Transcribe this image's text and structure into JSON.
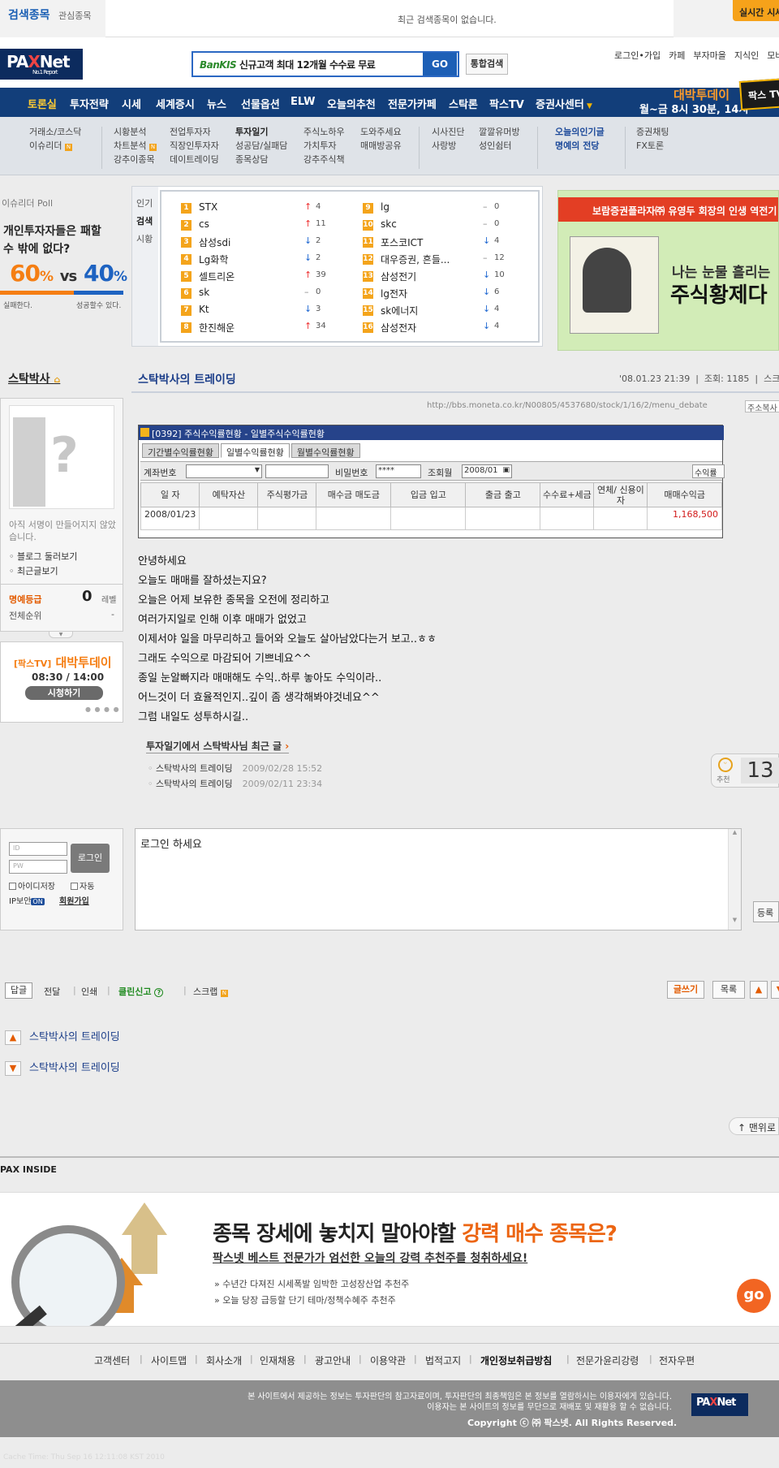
{
  "top_strip": {
    "tab_search": "검색종목",
    "tab_interest": "관심종목",
    "message": "최근 검색종목이 없습니다.",
    "realtime": "실시간 시세"
  },
  "header": {
    "logo_text": "PAXNet",
    "logo_sub": "No.1 Report",
    "search_brand": "BanKIS",
    "search_text": "신규고객 최대 12개월 수수료 무료",
    "go_label": "GO",
    "integrated_search": "통합검색",
    "links": [
      "로그인",
      "•가입",
      "카페",
      "부자마을",
      "지식인",
      "모바일"
    ]
  },
  "nav": {
    "items": [
      "토론실",
      "투자전략",
      "시세",
      "세계증시",
      "뉴스",
      "선물옵션",
      "ELW",
      "오늘의추천",
      "전문가카페",
      "스탁론",
      "팍스TV",
      "증권사센터"
    ],
    "active_index": 0,
    "promo_title": "대박투데이",
    "promo_time": "월~금 8시 30분, 14시",
    "tv_label": "팍스 TV"
  },
  "subnav": {
    "col1": [
      "거래소/코스닥",
      "이슈리더"
    ],
    "col2": [
      "시황분석",
      "차트분석",
      "강추이종목"
    ],
    "col3": [
      "전업투자자",
      "직장인투자자",
      "데이트레이딩"
    ],
    "col4": [
      "투자일기",
      "성공담/실패담",
      "종목상담"
    ],
    "col5": [
      "주식노하우",
      "가치투자",
      "강추주식책"
    ],
    "col6": [
      "도와주세요",
      "매매방공유"
    ],
    "col7": [
      "시사진단",
      "사랑방"
    ],
    "col8": [
      "깔깔유머방",
      "성인쉼터"
    ],
    "col9": [
      "오늘의인기글",
      "명예의 전당"
    ],
    "col10": [
      "증권채팅",
      "FX토론"
    ]
  },
  "poll": {
    "title": "이슈리더 Poll",
    "question_line1": "개인투자자들은 패할",
    "question_line2": "수 밖에 없다?",
    "left_pct": "60",
    "right_pct": "40",
    "pct_sign": "%",
    "vs": "vs",
    "left_fraction": 0.6,
    "left_label": "실패한다.",
    "right_label": "성공할수 있다."
  },
  "ranking": {
    "tabs": [
      "인기",
      "검색",
      "시황"
    ],
    "active_tab": 1,
    "left": [
      {
        "rank": "1",
        "name": "STX",
        "dir": "up",
        "change": "4"
      },
      {
        "rank": "2",
        "name": "cs",
        "dir": "up",
        "change": "11"
      },
      {
        "rank": "3",
        "name": "삼성sdi",
        "dir": "down",
        "change": "2"
      },
      {
        "rank": "4",
        "name": "Lg화학",
        "dir": "down",
        "change": "2"
      },
      {
        "rank": "5",
        "name": "셀트리온",
        "dir": "up",
        "change": "39"
      },
      {
        "rank": "6",
        "name": "sk",
        "dir": "same",
        "change": "0"
      },
      {
        "rank": "7",
        "name": "Kt",
        "dir": "down",
        "change": "3"
      },
      {
        "rank": "8",
        "name": "한진해운",
        "dir": "up",
        "change": "34"
      }
    ],
    "right": [
      {
        "rank": "9",
        "name": "lg",
        "dir": "same",
        "change": "0"
      },
      {
        "rank": "10",
        "name": "skc",
        "dir": "same",
        "change": "0"
      },
      {
        "rank": "11",
        "name": "포스코ICT",
        "dir": "down",
        "change": "4"
      },
      {
        "rank": "12",
        "name": "대우증권, 흔들...",
        "dir": "same",
        "change": "12"
      },
      {
        "rank": "13",
        "name": "삼성전기",
        "dir": "down",
        "change": "10"
      },
      {
        "rank": "14",
        "name": "lg전자",
        "dir": "down",
        "change": "6"
      },
      {
        "rank": "15",
        "name": "sk에너지",
        "dir": "down",
        "change": "4"
      },
      {
        "rank": "16",
        "name": "삼성전자",
        "dir": "down",
        "change": "4"
      }
    ]
  },
  "banner": {
    "top": "보람증권플라자㈜ 유영두 회장의 인생 역전기",
    "line1": "나는 눈물 흘리는",
    "line2": "주식황제다"
  },
  "profile": {
    "name": "스탁박사",
    "signature": "아직 서명이 만들어지지 않았습니다.",
    "blog_link": "블로그 둘러보기",
    "recent_link": "최근글보기",
    "honor_label": "명예등급",
    "honor_value": "0",
    "level_label": "레벨",
    "overall_label": "전체순위",
    "overall_value": "-"
  },
  "tv": {
    "tag": "[팍스TV]",
    "title": "대박투데이",
    "time": "08:30 / 14:00",
    "button": "시청하기"
  },
  "post": {
    "title": "스탁박사의 트레이딩",
    "date": "'08.01.23 21:39",
    "views_label": "조회:",
    "views": "1185",
    "scrap_label": "스크랩",
    "url": "http://bbs.moneta.co.kr/N00805/4537680/stock/1/16/2/menu_debate",
    "copy_label": "주소복사",
    "body": [
      "안녕하세요",
      "오늘도 매매를 잘하셨는지요?",
      "오늘은 어제 보유한 종목을 오전에 정리하고",
      "여러가지일로 인해 이후 매매가 없었고",
      "이제서야 일을 마무리하고 들어와 오늘도 살아남았다는거 보고..ㅎㅎ",
      "그래도 수익으로 마감되어 기쁘네요^^",
      "종일 눈알빠지라 매매해도 수익..하루 놓아도 수익이라..",
      "어느것이 더 효율적인지..깊이 좀 생각해봐야것네요^^",
      "그럼 내일도 성투하시길.."
    ],
    "recent_header": "투자일기에서 스탁박사님 최근 글",
    "recent": [
      {
        "title": "스탁박사의 트레이딩",
        "date": "2009/02/28 15:52"
      },
      {
        "title": "스탁박사의 트레이딩",
        "date": "2009/02/11 23:34"
      }
    ],
    "recommend_label": "추천",
    "recommend_count": "13"
  },
  "embedded": {
    "header": "[0392] 주식수익률현황 - 일별주식수익률현황",
    "tabs": [
      "기간별수익률현황",
      "일별수익률현황",
      "월별수익률현황"
    ],
    "active_tab": 1,
    "account_label": "계좌번호",
    "password_label": "비밀번호",
    "password_value": "****",
    "date_label": "조회월",
    "date_value": "2008/01",
    "profit_button": "수익률",
    "columns": [
      "일 자",
      "예탁자산",
      "주식평가금",
      "매수금 매도금",
      "입금 입고",
      "출금 출고",
      "수수료+세금",
      "연체/ 신용이자",
      "매매수익금"
    ],
    "row": {
      "date": "2008/01/23",
      "profit": "1,168,500"
    }
  },
  "login": {
    "id_placeholder": "ID",
    "pw_placeholder": "PW",
    "button": "로그인",
    "save_id": "아이디저장",
    "auto": "자동",
    "ip_label": "IP보안",
    "ip_state": "ON",
    "join": "회원가입"
  },
  "comment": {
    "placeholder": "로그인 하세요",
    "register": "등록"
  },
  "actions": {
    "reply": "답글",
    "forward": "전달",
    "print": "인쇄",
    "clean": "클린신고",
    "scrap": "스크랩",
    "write": "글쓰기",
    "list": "목록"
  },
  "prev_next": [
    "스탁박사의 트레이딩",
    "스탁박사의 트레이딩"
  ],
  "to_top": "맨위로",
  "pax_inside": {
    "title": "PAX INSIDE",
    "headline_a": "종목 장세에 놓치지 말아야할 ",
    "headline_b": "강력 매수 종목은?",
    "sub": "팍스넷 베스트 전문가가 엄선한 오늘의 강력 추천주를 청취하세요!",
    "items": [
      "» 수년간 다져진 시세폭발 임박한 고성장산업 추천주",
      "» 오늘 당장 급등할 단기 테마/정책수혜주 추천주"
    ],
    "go": "go"
  },
  "footer_links": [
    "고객센터",
    "사이트맵",
    "회사소개",
    "인재채용",
    "광고안내",
    "이용약관",
    "법적고지",
    "개인정보취급방침",
    "전문가윤리강령",
    "전자우편"
  ],
  "footer": {
    "disclaimer1": "본 사이트에서 제공하는 정보는 투자판단의 참고자료이며, 투자판단의 최종책임은 본 정보를 열람하시는 이용자에게 있습니다.",
    "disclaimer2": "이용자는 본 사이트의 정보를 무단으로 재배포 및 재활용 할 수 없습니다.",
    "copyright": "Copyright ⓒ ㈜ 팍스넷. All Rights Reserved.",
    "cache": "Cache Time: Thu Sep 16 12:11:08 KST 2010"
  },
  "colors": {
    "nav_bg": "#123e7a",
    "accent_orange": "#f57e13",
    "link_blue": "#1d3f8a",
    "rank_badge": "#f4a41b"
  }
}
